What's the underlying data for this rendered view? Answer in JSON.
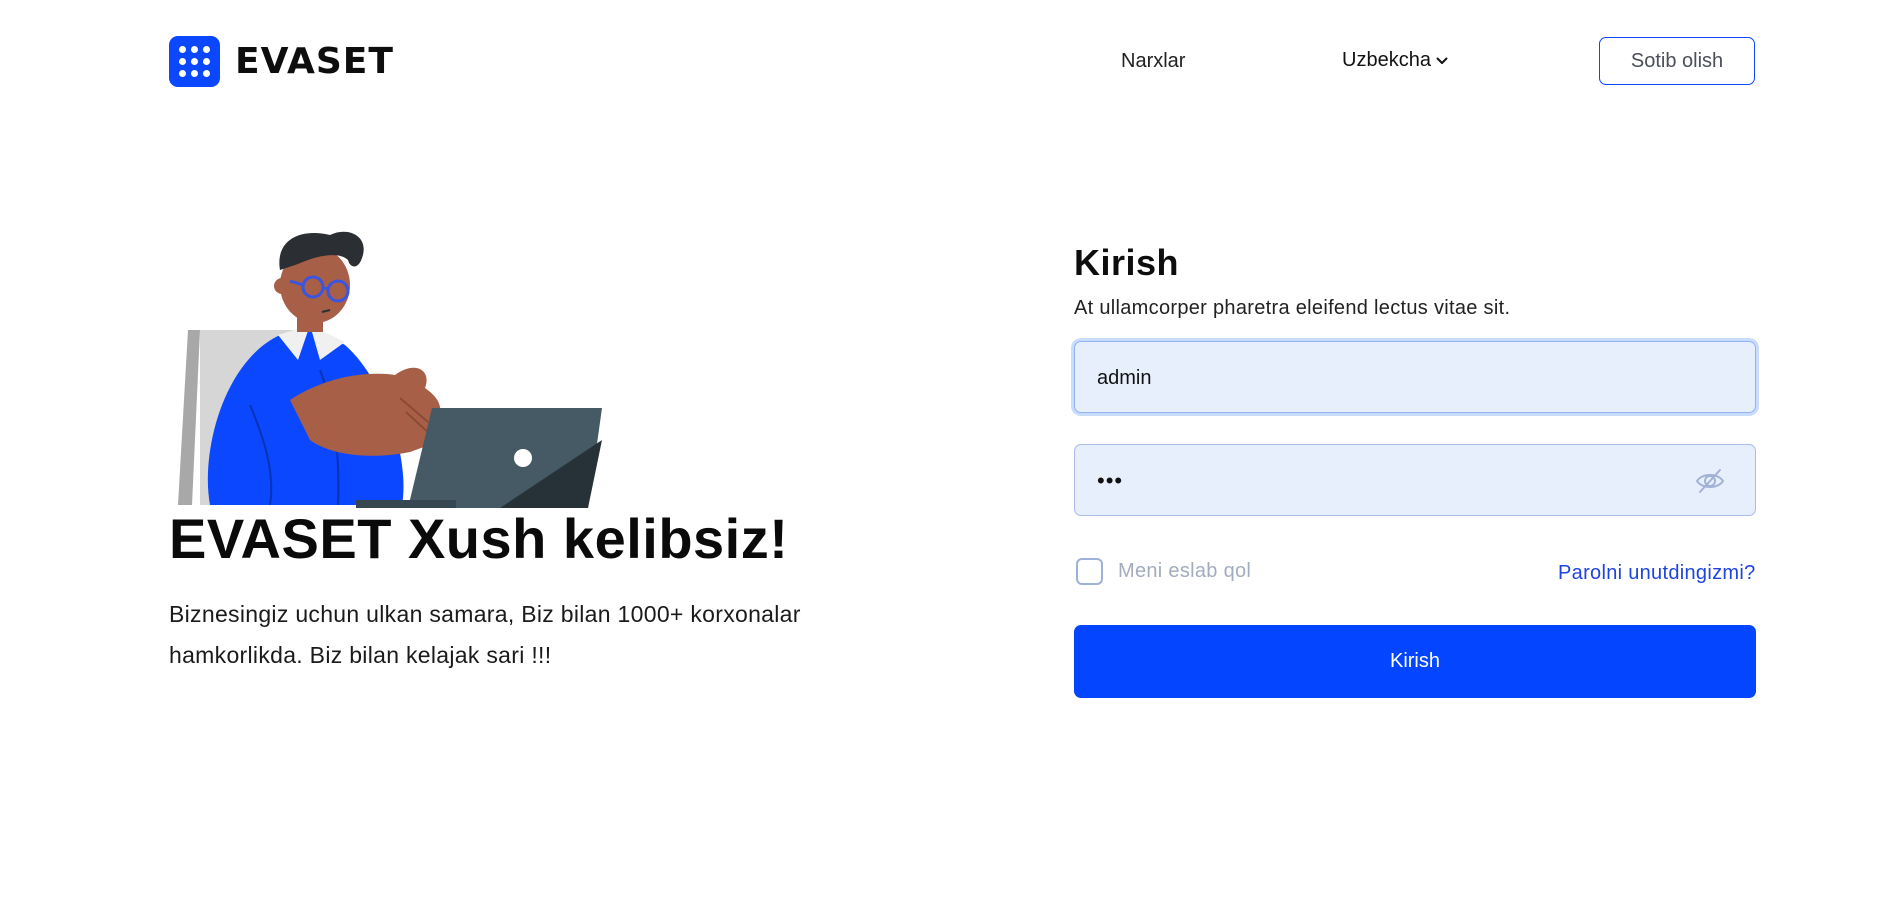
{
  "brand": {
    "name": "EVASET",
    "color": "#0A47FF",
    "logo_icon": "dots-grid-icon"
  },
  "nav": {
    "prices_label": "Narxlar",
    "language_label": "Uzbekcha",
    "buy_label": "Sotib olish"
  },
  "hero": {
    "illustration": "man-with-laptop-illustration",
    "title": "EVASET Xush kelibsiz!",
    "text": "Biznesingiz uchun ulkan samara, Biz bilan 1000+ korxonalar hamkorlikda. Biz bilan kelajak sari !!!"
  },
  "login": {
    "title": "Kirish",
    "subtitle": "At ullamcorper pharetra eleifend lectus vitae sit.",
    "username_value": "admin",
    "password_value": "•••",
    "password_toggle_icon": "eye-off-icon",
    "remember_label": "Meni eslab qol",
    "remember_checked": false,
    "forgot_label": "Parolni unutdingizmi?",
    "submit_label": "Kirish"
  }
}
